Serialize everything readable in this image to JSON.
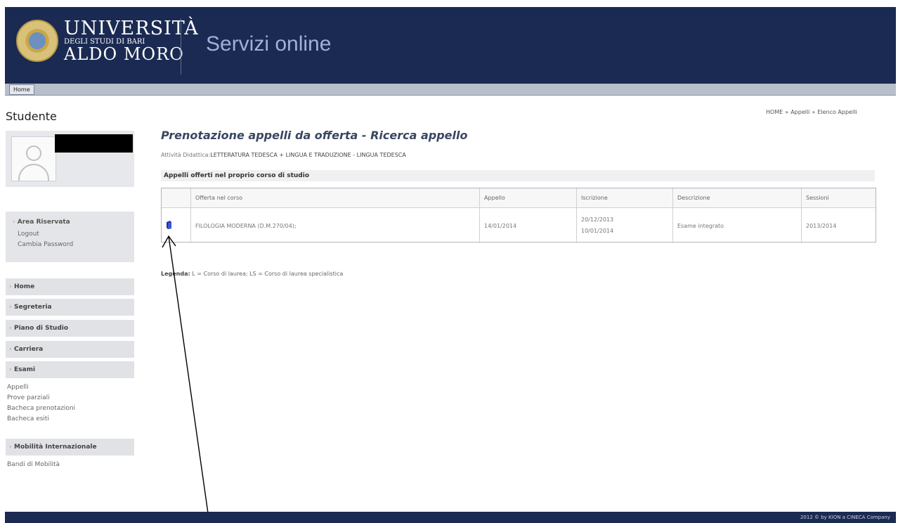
{
  "header": {
    "logo_line1": "UNIVERSITÀ",
    "logo_line2": "DEGLI STUDI DI BARI",
    "logo_line3": "ALDO MORO",
    "title": "Servizi online"
  },
  "navbar": {
    "home_tab": "Home"
  },
  "sidebar": {
    "title": "Studente",
    "area": {
      "title": "Area Riservata",
      "logout": "Logout",
      "change_password": "Cambia Password"
    },
    "menu": [
      {
        "label": "Home"
      },
      {
        "label": "Segreteria"
      },
      {
        "label": "Piano di Studio"
      },
      {
        "label": "Carriera"
      },
      {
        "label": "Esami"
      }
    ],
    "esami_sub": [
      "Appelli",
      "Prove parziali",
      "Bacheca prenotazioni",
      "Bacheca esiti"
    ],
    "mobility": {
      "label": "Mobilità Internazionale",
      "sub": "Bandi di Mobilità"
    }
  },
  "breadcrumb": {
    "home": "HOME",
    "appelli": "Appelli",
    "current": "Elenco Appelli",
    "separator": "»"
  },
  "main": {
    "title": "Prenotazione appelli da offerta - Ricerca appello",
    "activity_label": "Attività Didattica:",
    "activity_value": "LETTERATURA TEDESCA + LINGUA E TRADUZIONE - LINGUA TEDESCA",
    "section_title": "Appelli offerti nel proprio corso di studio",
    "table": {
      "headers": [
        "",
        "Offerta nel corso",
        "Appello",
        "Iscrizione",
        "Descrizione",
        "Sessioni"
      ],
      "rows": [
        {
          "offerta": "FILOLOGIA MODERNA (D.M.270/04);",
          "appello": "14/01/2014",
          "iscrizione_from": "20/12/2013",
          "iscrizione_to": "10/01/2014",
          "descrizione": "Esame integrato",
          "sessioni": "2013/2014"
        }
      ]
    },
    "legend_label": "Legenda:",
    "legend_text": "L = Corso di laurea; LS = Corso di laurea specialistica"
  },
  "footer": {
    "text": "2012 © by KION a CINECA Company"
  },
  "colors": {
    "header_bg": "#1b2a52",
    "title_blue": "#3a4763",
    "menu_bg": "#e1e2e6"
  },
  "icons": {
    "row_action": "book-icon",
    "annotation": "arrow-annotation"
  }
}
